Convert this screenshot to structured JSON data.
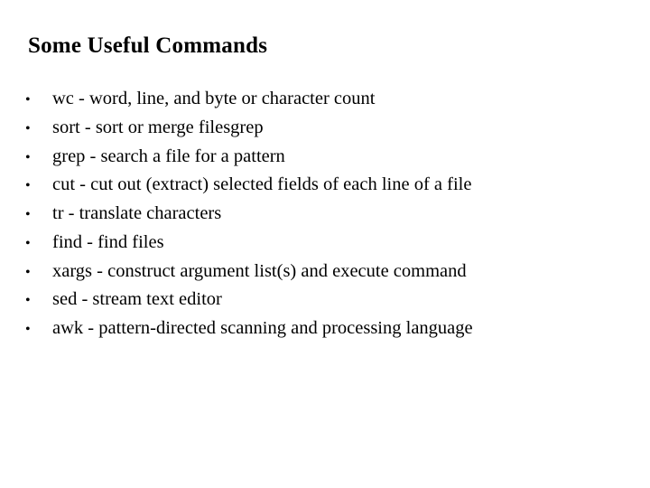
{
  "slide": {
    "title": "Some Useful Commands",
    "bullet_glyph": "•",
    "items": [
      {
        "text": "wc - word, line, and byte or character count"
      },
      {
        "text": "sort - sort or merge filesgrep"
      },
      {
        "text": "grep - search a file for a pattern"
      },
      {
        "text": "cut - cut out (extract) selected fields of each line of a file"
      },
      {
        "text": "tr - translate characters"
      },
      {
        "text": "find - find files"
      },
      {
        "text": "xargs - construct argument list(s) and execute command"
      },
      {
        "text": "sed - stream text editor"
      },
      {
        "text": "awk - pattern-directed scanning and processing language"
      }
    ]
  }
}
